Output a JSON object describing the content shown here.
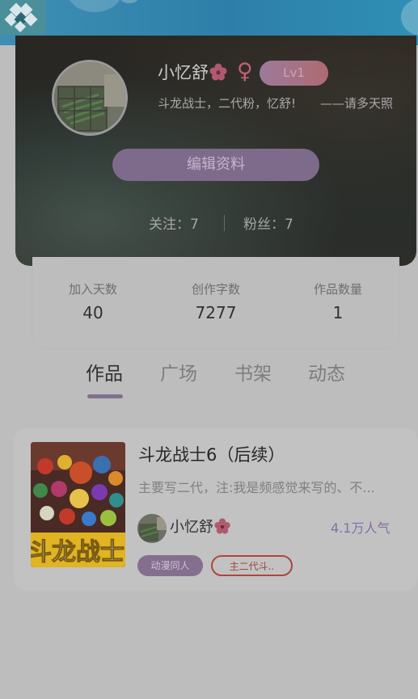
{
  "header": {
    "username": "小忆舒",
    "gender_symbol": "♀",
    "level": "Lv1",
    "bio": "斗龙战士，二代粉，忆舒!　　——请多天照",
    "edit_button_label": "编辑资料",
    "following_label": "关注：7",
    "followers_label": "粉丝：7"
  },
  "stats": [
    {
      "label": "加入天数",
      "value": "40"
    },
    {
      "label": "创作字数",
      "value": "7277"
    },
    {
      "label": "作品数量",
      "value": "1"
    }
  ],
  "tabs": [
    {
      "label": "作品",
      "active": true
    },
    {
      "label": "广场",
      "active": false
    },
    {
      "label": "书架",
      "active": false
    },
    {
      "label": "动态",
      "active": false
    }
  ],
  "book": {
    "title": "斗龙战士6（后续）",
    "description": "主要写二代，注:我是频感觉来写的、不...",
    "author": "小忆舒",
    "popularity": "4.1万人气",
    "cover_text": "斗龙战士",
    "tags": [
      "动漫同人",
      "主二代斗.."
    ]
  },
  "colors": {
    "accent_purple": "#7e6a8a",
    "level_badge": "#b06a72",
    "tag_outline": "#b0443d",
    "topbar": "#2d7fa9"
  },
  "icons": {
    "app_logo": "diamond-logo-icon",
    "flower": "flower-icon",
    "gender": "female-icon"
  }
}
